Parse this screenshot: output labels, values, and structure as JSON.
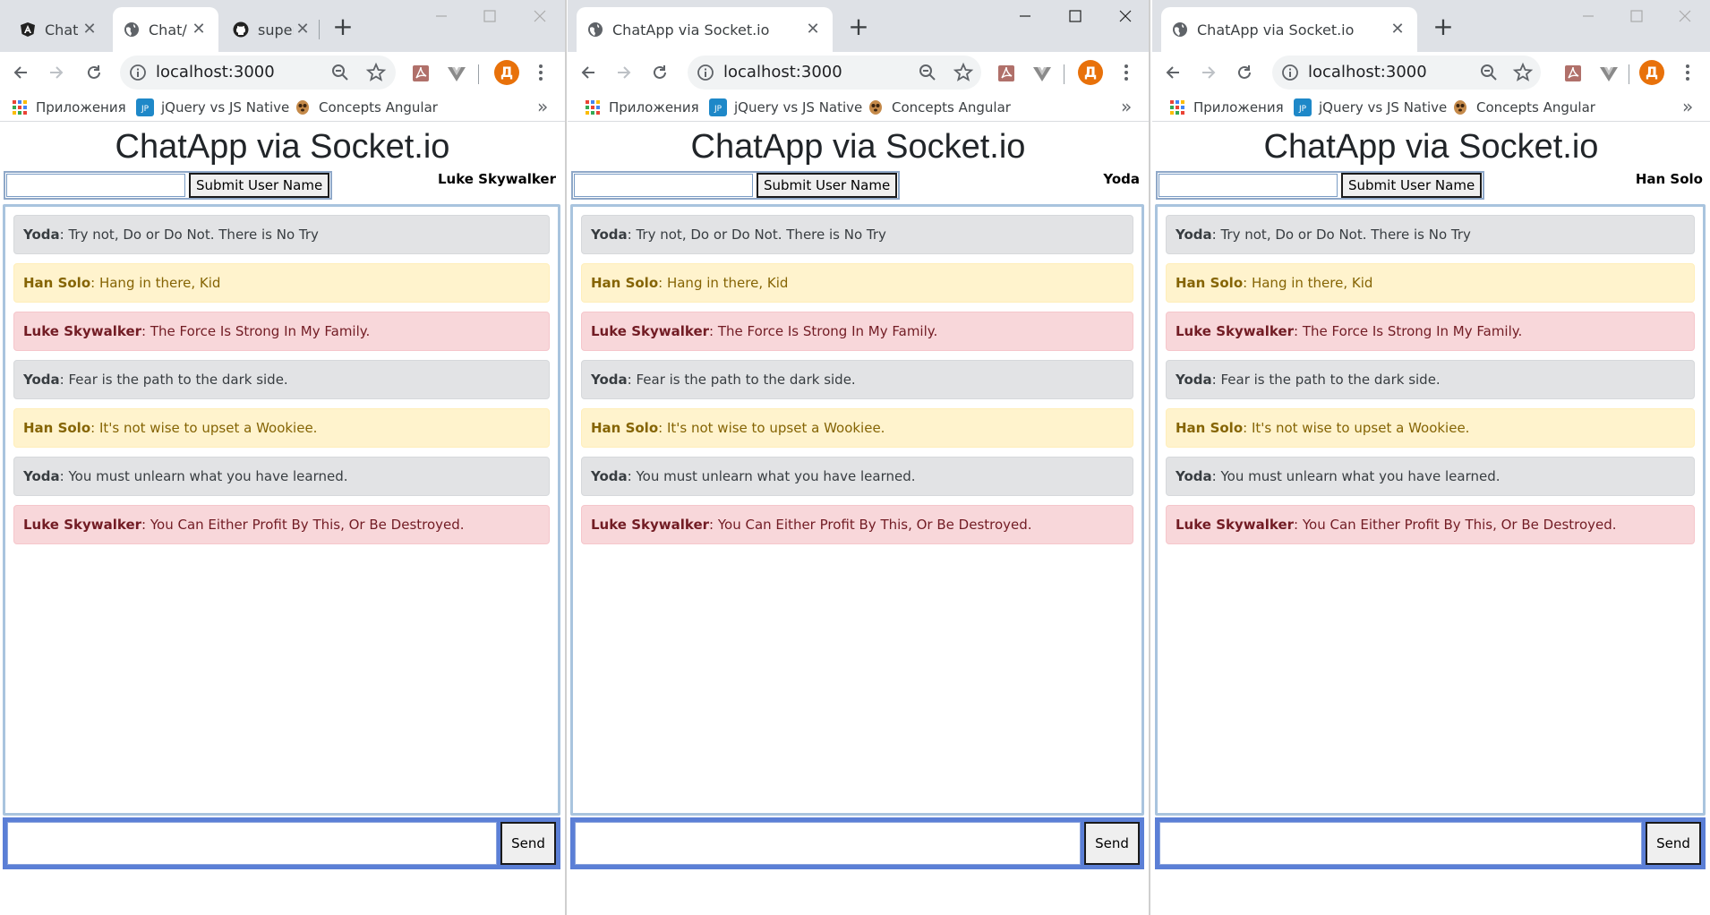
{
  "colors": {
    "tabstrip_bg": "#dee1e6",
    "message_yoda_bg": "#e2e3e5",
    "message_han_bg": "#fff3cd",
    "message_luke_bg": "#f8d7da",
    "send_bar": "#5b7fd6",
    "avatar": "#e8710a"
  },
  "windows": [
    {
      "tabs": [
        {
          "title": "Chat",
          "icon": "angular-icon",
          "active": false
        },
        {
          "title": "Chat/",
          "icon": "globe-icon",
          "active": true
        },
        {
          "title": "super",
          "icon": "github-icon",
          "active": false
        }
      ],
      "address": {
        "url": "localhost:3000"
      },
      "avatar_letter": "Д",
      "bookmarks": [
        {
          "label": "Приложения",
          "icon": "apps-grid-icon"
        },
        {
          "label": "jQuery vs JS Native",
          "icon": "jp-icon"
        },
        {
          "label": "Concepts Angular",
          "icon": "meerkat-icon"
        }
      ],
      "bookmarks_more": "»",
      "page": {
        "title": "ChatApp via Socket.io",
        "submit_label": "Submit User Name",
        "current_user": "Luke Skywalker",
        "send_label": "Send"
      }
    },
    {
      "tabs": [
        {
          "title": "ChatApp via Socket.io",
          "icon": "globe-icon",
          "active": true
        }
      ],
      "address": {
        "url": "localhost:3000"
      },
      "avatar_letter": "Д",
      "bookmarks": [
        {
          "label": "Приложения",
          "icon": "apps-grid-icon"
        },
        {
          "label": "jQuery vs JS Native",
          "icon": "jp-icon"
        },
        {
          "label": "Concepts Angular",
          "icon": "meerkat-icon"
        }
      ],
      "bookmarks_more": "»",
      "page": {
        "title": "ChatApp via Socket.io",
        "submit_label": "Submit User Name",
        "current_user": "Yoda",
        "send_label": "Send"
      }
    },
    {
      "tabs": [
        {
          "title": "ChatApp via Socket.io",
          "icon": "globe-icon",
          "active": true
        }
      ],
      "address": {
        "url": "localhost:3000"
      },
      "avatar_letter": "Д",
      "bookmarks": [
        {
          "label": "Приложения",
          "icon": "apps-grid-icon"
        },
        {
          "label": "jQuery vs JS Native",
          "icon": "jp-icon"
        },
        {
          "label": "Concepts Angular",
          "icon": "meerkat-icon"
        }
      ],
      "bookmarks_more": "»",
      "page": {
        "title": "ChatApp via Socket.io",
        "submit_label": "Submit User Name",
        "current_user": "Han Solo",
        "send_label": "Send"
      }
    }
  ],
  "messages": [
    {
      "author": "Yoda",
      "text": ": Try not, Do or Do Not. There is No Try",
      "style": "grey"
    },
    {
      "author": "Han Solo",
      "text": ": Hang in there, Kid",
      "style": "yellow"
    },
    {
      "author": "Luke Skywalker",
      "text": ": The Force Is Strong In My Family.",
      "style": "red"
    },
    {
      "author": "Yoda",
      "text": ": Fear is the path to the dark side.",
      "style": "grey"
    },
    {
      "author": "Han Solo",
      "text": ": It's not wise to upset a Wookiee.",
      "style": "yellow"
    },
    {
      "author": "Yoda",
      "text": ": You must unlearn what you have learned.",
      "style": "grey"
    },
    {
      "author": "Luke Skywalker",
      "text": ": You Can Either Profit By This, Or Be Destroyed.",
      "style": "red"
    }
  ]
}
